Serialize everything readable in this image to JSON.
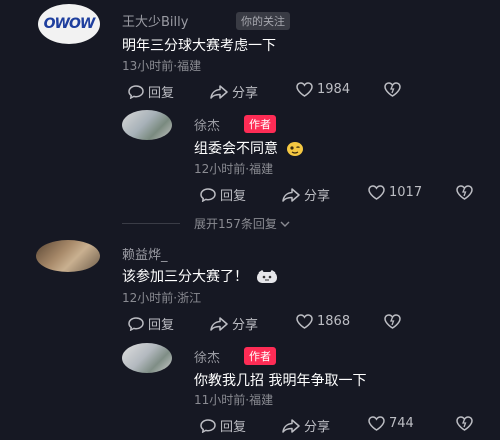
{
  "comments": [
    {
      "avatar_text": "OWOW",
      "username": "王大少Billy",
      "follow_badge": "你的关注",
      "text": "明年三分球大赛考虑一下",
      "meta": "13小时前·福建",
      "reply_label": "回复",
      "share_label": "分享",
      "likes": "1984"
    },
    {
      "username": "徐杰",
      "author_badge": "作者",
      "text": "组委会不同意",
      "meta": "12小时前·福建",
      "reply_label": "回复",
      "share_label": "分享",
      "likes": "1017"
    },
    {
      "username": "赖益烨_",
      "text": "该参加三分大赛了！",
      "meta": "12小时前·浙江",
      "reply_label": "回复",
      "share_label": "分享",
      "likes": "1868"
    },
    {
      "username": "徐杰",
      "author_badge": "作者",
      "text": "你教我几招 我明年争取一下",
      "meta": "11小时前·福建",
      "reply_label": "回复",
      "share_label": "分享",
      "likes": "744"
    }
  ],
  "expand_replies": "展开157条回复",
  "colors": {
    "background": "#161823",
    "author_badge": "#fe2c55",
    "text": "#ffffff",
    "muted": "#8a8b92"
  },
  "icons": [
    "comment-icon",
    "share-arrow-icon",
    "heart-icon",
    "broken-heart-icon",
    "chevron-down-icon",
    "emoji-icon"
  ]
}
